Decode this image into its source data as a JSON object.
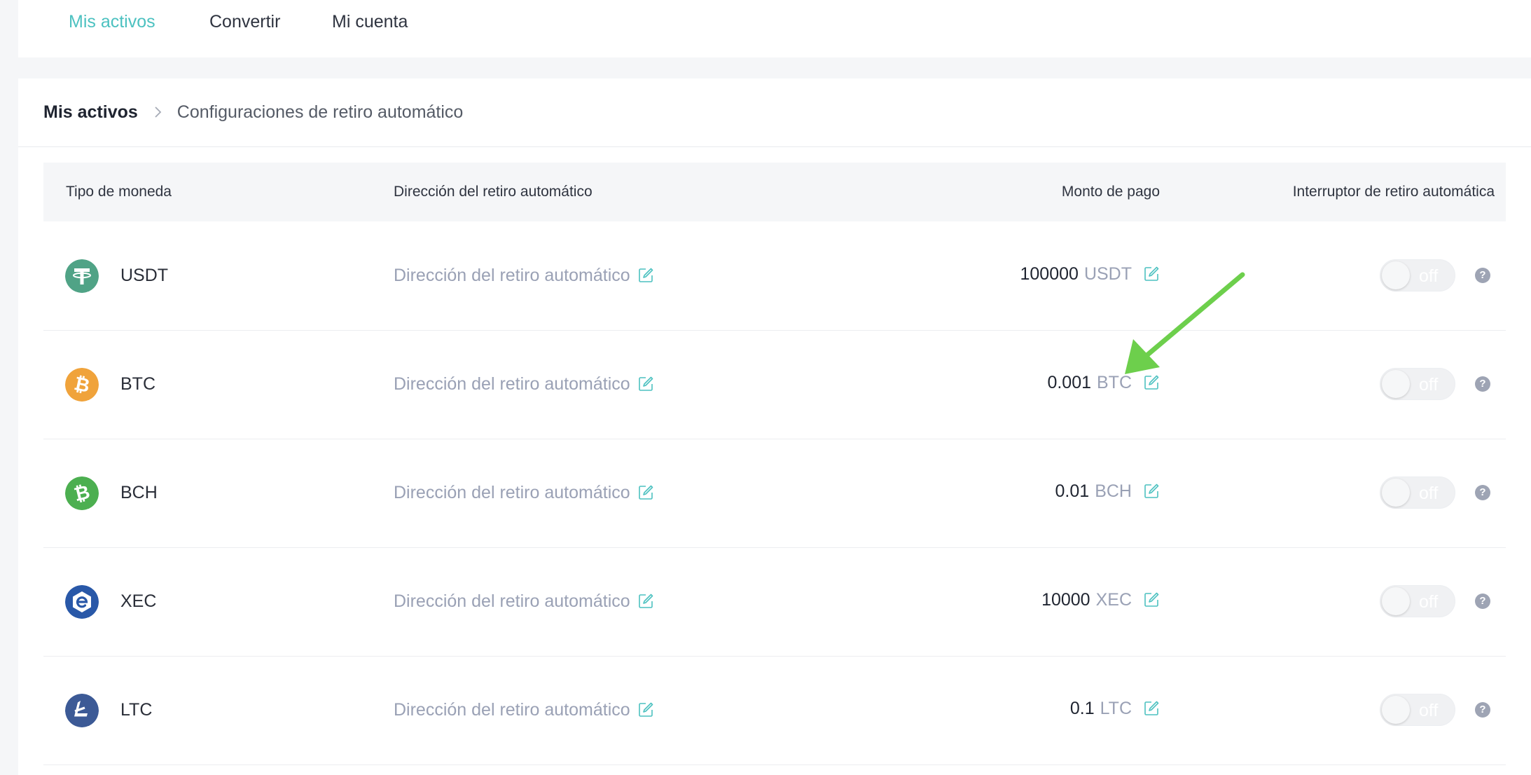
{
  "nav": {
    "items": [
      {
        "label": "Mis activos",
        "active": true
      },
      {
        "label": "Convertir",
        "active": false
      },
      {
        "label": "Mi cuenta",
        "active": false
      }
    ]
  },
  "breadcrumb": {
    "root": "Mis activos",
    "current": "Configuraciones de retiro automático"
  },
  "table": {
    "headers": {
      "coin": "Tipo de moneda",
      "address": "Dirección del retiro automático",
      "amount": "Monto de pago",
      "switch": "Interruptor de retiro automática"
    },
    "rows": [
      {
        "coin": "USDT",
        "address": "Dirección del retiro automático",
        "amount": "100000",
        "unit": "USDT",
        "switch": "off",
        "help": "?",
        "icon": "usdt-icon",
        "color": "#50a386"
      },
      {
        "coin": "BTC",
        "address": "Dirección del retiro automático",
        "amount": "0.001",
        "unit": "BTC",
        "switch": "off",
        "help": "?",
        "icon": "btc-icon",
        "color": "#f0a33b"
      },
      {
        "coin": "BCH",
        "address": "Dirección del retiro automático",
        "amount": "0.01",
        "unit": "BCH",
        "switch": "off",
        "help": "?",
        "icon": "bch-icon",
        "color": "#4caf50"
      },
      {
        "coin": "XEC",
        "address": "Dirección del retiro automático",
        "amount": "10000",
        "unit": "XEC",
        "switch": "off",
        "help": "?",
        "icon": "xec-icon",
        "color": "#2958a8"
      },
      {
        "coin": "LTC",
        "address": "Dirección del retiro automático",
        "amount": "0.1",
        "unit": "LTC",
        "switch": "off",
        "help": "?",
        "icon": "ltc-icon",
        "color": "#3c5a96"
      }
    ]
  },
  "colors": {
    "accent": "#4cc1c0",
    "muted_text": "#9aa1b5",
    "annotation_arrow": "#6dcf4c"
  }
}
